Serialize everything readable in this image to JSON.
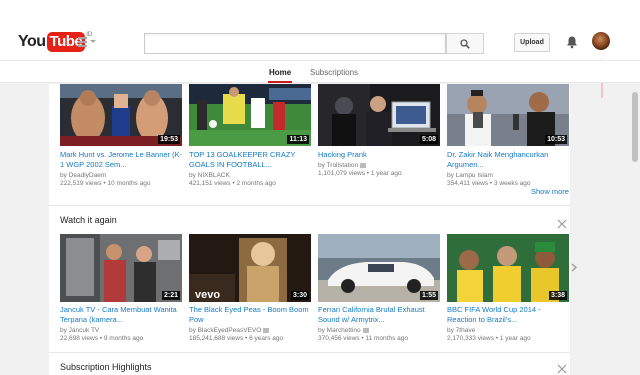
{
  "header": {
    "logo_you": "You",
    "logo_tube": "Tube",
    "logo_region": "ID",
    "upload_label": "Upload",
    "search": {
      "placeholder": ""
    }
  },
  "subnav": {
    "tabs": [
      {
        "label": "Home",
        "active": true
      },
      {
        "label": "Subscriptions",
        "active": false
      }
    ]
  },
  "row1": {
    "show_more": "Show more",
    "videos": [
      {
        "title": "Mark Hunt vs. Jerome Le Banner (K-1 WGP 2002 Sem...",
        "channel": "by DeadlyDaem",
        "views": "222,519 views",
        "age": "10 months ago",
        "duration": "19:53",
        "verified": false
      },
      {
        "title": "TOP 13 GOALKEEPER CRAZY GOALS IN FOOTBALL...",
        "channel": "by NIXBLACK",
        "views": "421,151 views",
        "age": "2 months ago",
        "duration": "11:13",
        "verified": false
      },
      {
        "title": "Hacking Prank",
        "channel": "by Trollstation",
        "views": "1,101,079 views",
        "age": "1 year ago",
        "duration": "5:08",
        "verified": true
      },
      {
        "title": "Dr. Zakir Naik Menghancurkan Argumen...",
        "channel": "by Lampu Islam",
        "views": "354,411 views",
        "age": "3 weeks ago",
        "duration": "10:53",
        "verified": false
      }
    ]
  },
  "section_watch": {
    "title": "Watch it again",
    "videos": [
      {
        "title": "Jancuk TV - Cara Membuat Wanita Terpana (kamera...",
        "channel": "by Jancuk TV",
        "views": "22,698 views",
        "age": "9 months ago",
        "duration": "2:21",
        "verified": false
      },
      {
        "title": "The Black Eyed Peas - Boom Boom Pow",
        "channel": "by BlackEyedPeasVEVO",
        "views": "185,241,688 views",
        "age": "6 years ago",
        "duration": "3:30",
        "verified": true,
        "badge": "vevo"
      },
      {
        "title": "Ferrari California Brutal Exhaust Sound w/ Armytrix...",
        "channel": "by Marchettino",
        "views": "370,456 views",
        "age": "11 months ago",
        "duration": "1:55",
        "verified": true
      },
      {
        "title": "BBC FIFA World Cup 2014 - Reaction to Brazil's...",
        "channel": "by 7thave",
        "views": "2,170,333 views",
        "age": "1 year ago",
        "duration": "3:38",
        "verified": false
      }
    ]
  },
  "section_subs": {
    "title": "Subscription Highlights"
  },
  "colors": {
    "brand_red": "#e62117",
    "link_blue": "#167ac6",
    "active_underline": "#cc181e",
    "annotation_arrow": "#f2a1b0"
  },
  "icons": {
    "search": "search-icon",
    "bell": "notification-bell-icon",
    "guide": "guide-menu-icon",
    "close": "close-icon",
    "next": "chevron-right-icon"
  }
}
